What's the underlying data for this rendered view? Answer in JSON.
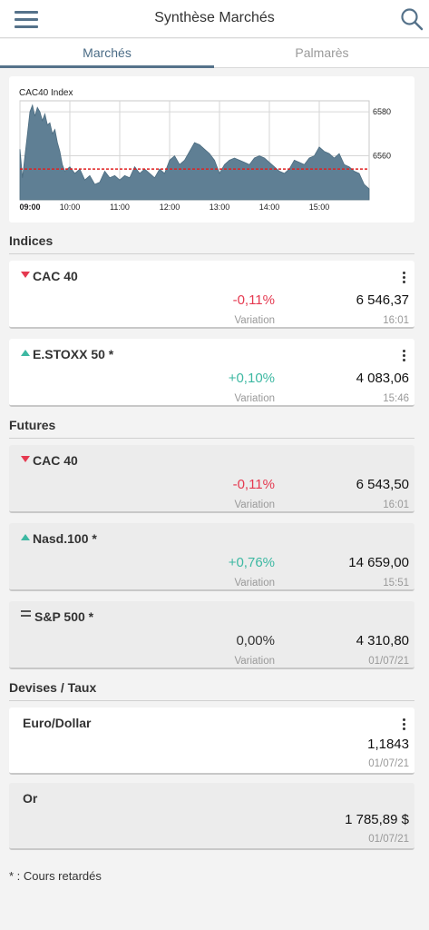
{
  "header": {
    "title": "Synthèse Marchés",
    "menu_icon": "hamburger-menu-icon",
    "search_icon": "search-icon"
  },
  "tabs": [
    {
      "label": "Marchés",
      "active": true
    },
    {
      "label": "Palmarès",
      "active": false
    }
  ],
  "chart_data": {
    "type": "area",
    "title": "CAC40 Index",
    "x_ticks": [
      "09:00",
      "10:00",
      "11:00",
      "12:00",
      "13:00",
      "14:00",
      "15:00"
    ],
    "y_ticks": [
      6580,
      6560
    ],
    "ylim": [
      6540,
      6585
    ],
    "reference_line": 6554,
    "color": "#5f7f94",
    "reference_color": "#e02020",
    "x_hours": [
      9.0,
      9.05,
      9.1,
      9.15,
      9.2,
      9.25,
      9.3,
      9.35,
      9.4,
      9.45,
      9.5,
      9.55,
      9.6,
      9.65,
      9.7,
      9.75,
      9.8,
      9.85,
      9.9,
      10.0,
      10.1,
      10.2,
      10.3,
      10.4,
      10.5,
      10.6,
      10.7,
      10.8,
      10.9,
      11.0,
      11.1,
      11.2,
      11.3,
      11.4,
      11.5,
      11.6,
      11.7,
      11.8,
      11.9,
      12.0,
      12.1,
      12.2,
      12.3,
      12.4,
      12.5,
      12.6,
      12.7,
      12.8,
      12.9,
      13.0,
      13.1,
      13.2,
      13.3,
      13.4,
      13.5,
      13.6,
      13.7,
      13.8,
      13.9,
      14.0,
      14.1,
      14.2,
      14.3,
      14.4,
      14.5,
      14.6,
      14.7,
      14.8,
      14.9,
      15.0,
      15.1,
      15.2,
      15.3,
      15.4,
      15.5,
      15.6,
      15.7,
      15.8,
      15.9,
      16.0
    ],
    "values": [
      6563,
      6550,
      6560,
      6570,
      6580,
      6583,
      6578,
      6582,
      6580,
      6576,
      6579,
      6574,
      6575,
      6570,
      6572,
      6566,
      6562,
      6556,
      6553,
      6555,
      6552,
      6554,
      6549,
      6551,
      6547,
      6548,
      6553,
      6550,
      6551,
      6549,
      6551,
      6550,
      6555,
      6552,
      6554,
      6552,
      6550,
      6554,
      6552,
      6558,
      6560,
      6556,
      6558,
      6562,
      6566,
      6565,
      6563,
      6561,
      6558,
      6552,
      6556,
      6558,
      6559,
      6558,
      6557,
      6556,
      6559,
      6560,
      6559,
      6557,
      6555,
      6553,
      6552,
      6554,
      6558,
      6557,
      6556,
      6559,
      6560,
      6564,
      6562,
      6561,
      6559,
      6561,
      6556,
      6555,
      6553,
      6552,
      6547,
      6545
    ]
  },
  "sections": {
    "indices": "Indices",
    "futures": "Futures",
    "devises": "Devises / Taux"
  },
  "indices": [
    {
      "name": "CAC 40",
      "trend": "down",
      "variation": "-0,11%",
      "value": "6 546,37",
      "variation_label": "Variation",
      "time": "16:01"
    },
    {
      "name": "E.STOXX 50 *",
      "trend": "up",
      "variation": "+0,10%",
      "value": "4 083,06",
      "variation_label": "Variation",
      "time": "15:46"
    }
  ],
  "futures": [
    {
      "name": "CAC 40",
      "trend": "down",
      "variation": "-0,11%",
      "value": "6 543,50",
      "variation_label": "Variation",
      "time": "16:01"
    },
    {
      "name": "Nasd.100 *",
      "trend": "up",
      "variation": "+0,76%",
      "value": "14 659,00",
      "variation_label": "Variation",
      "time": "15:51"
    },
    {
      "name": "S&P 500 *",
      "trend": "flat",
      "variation": "0,00%",
      "value": "4 310,80",
      "variation_label": "Variation",
      "time": "01/07/21"
    }
  ],
  "devises": [
    {
      "name": "Euro/Dollar",
      "value": "1,1843",
      "time": "01/07/21"
    },
    {
      "name": "Or",
      "value": "1 785,89 $",
      "time": "01/07/21"
    }
  ],
  "footnote": "* : Cours retardés",
  "colors": {
    "negative": "#e53950",
    "positive": "#3db8a2",
    "accent": "#55728a"
  }
}
